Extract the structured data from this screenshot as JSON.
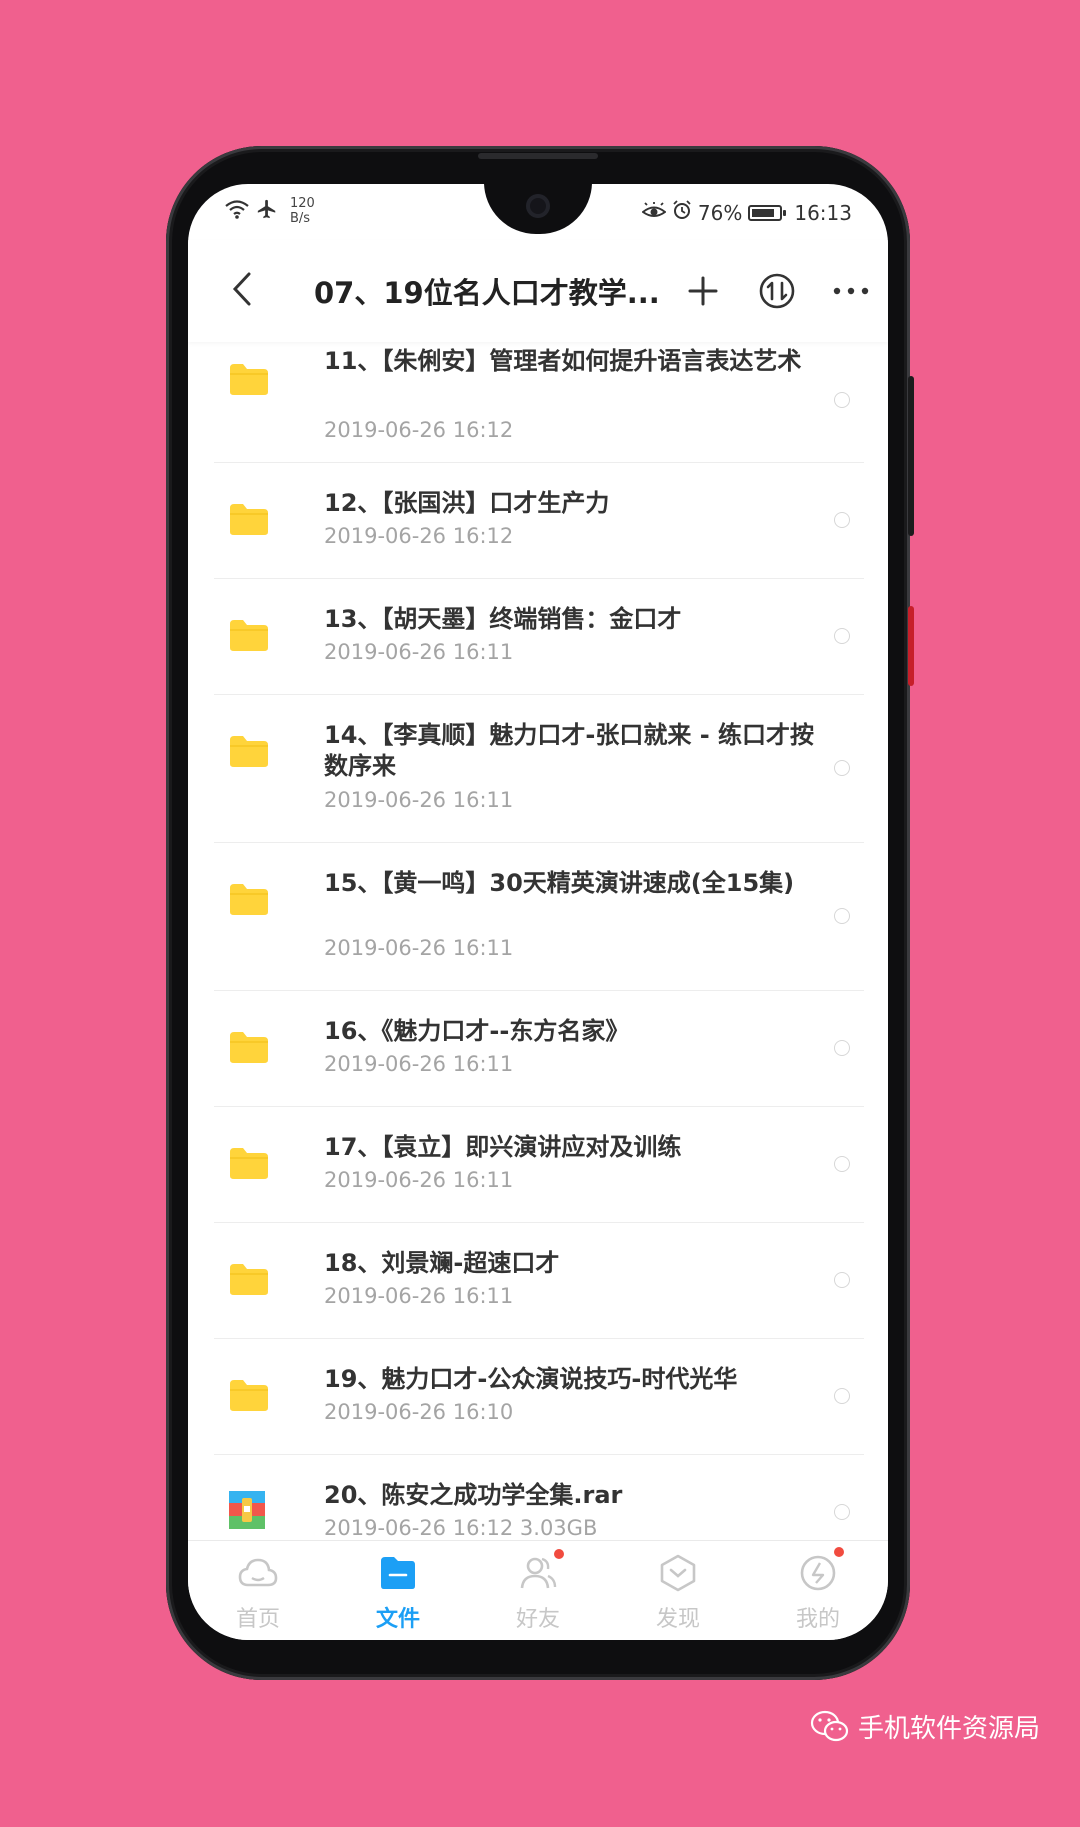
{
  "status_bar": {
    "net_speed_value": "120",
    "net_speed_unit": "B/s",
    "battery": "76%",
    "time": "16:13"
  },
  "header": {
    "title": "07、19位名人口才教学..."
  },
  "files": [
    {
      "name": "11、【朱俐安】管理者如何提升语言表达艺术",
      "date": "2019-06-26  16:12",
      "type": "folder"
    },
    {
      "name": "12、【张国洪】口才生产力",
      "date": "2019-06-26  16:12",
      "type": "folder"
    },
    {
      "name": "13、【胡天墨】终端销售：金口才",
      "date": "2019-06-26  16:11",
      "type": "folder"
    },
    {
      "name": "14、【李真顺】魅力口才-张口就来 - 练口才按数序来",
      "date": "2019-06-26  16:11",
      "type": "folder"
    },
    {
      "name": "15、【黄一鸣】30天精英演讲速成(全15集)",
      "date": "2019-06-26  16:11",
      "type": "folder"
    },
    {
      "name": "16、《魅力口才--东方名家》",
      "date": "2019-06-26  16:11",
      "type": "folder"
    },
    {
      "name": "17、【袁立】即兴演讲应对及训练",
      "date": "2019-06-26  16:11",
      "type": "folder"
    },
    {
      "name": "18、刘景斓-超速口才",
      "date": "2019-06-26  16:11",
      "type": "folder"
    },
    {
      "name": "19、魅力口才-公众演说技巧-时代光华",
      "date": "2019-06-26  16:10",
      "type": "folder"
    },
    {
      "name": "20、陈安之成功学全集.rar",
      "date": "2019-06-26  16:12   3.03GB",
      "type": "archive"
    }
  ],
  "tabs": [
    {
      "label": "首页",
      "icon": "cloud-icon",
      "active": false,
      "badge": false
    },
    {
      "label": "文件",
      "icon": "folder-icon",
      "active": true,
      "badge": false
    },
    {
      "label": "好友",
      "icon": "friends-icon",
      "active": false,
      "badge": true
    },
    {
      "label": "发现",
      "icon": "discover-icon",
      "active": false,
      "badge": false
    },
    {
      "label": "我的",
      "icon": "profile-icon",
      "active": false,
      "badge": true
    }
  ],
  "watermark": {
    "text": "手机软件资源局"
  },
  "colors": {
    "background": "#F0608E",
    "accent": "#1C9FF5",
    "folder": "#FFD43B",
    "badge": "#F14B3F"
  }
}
